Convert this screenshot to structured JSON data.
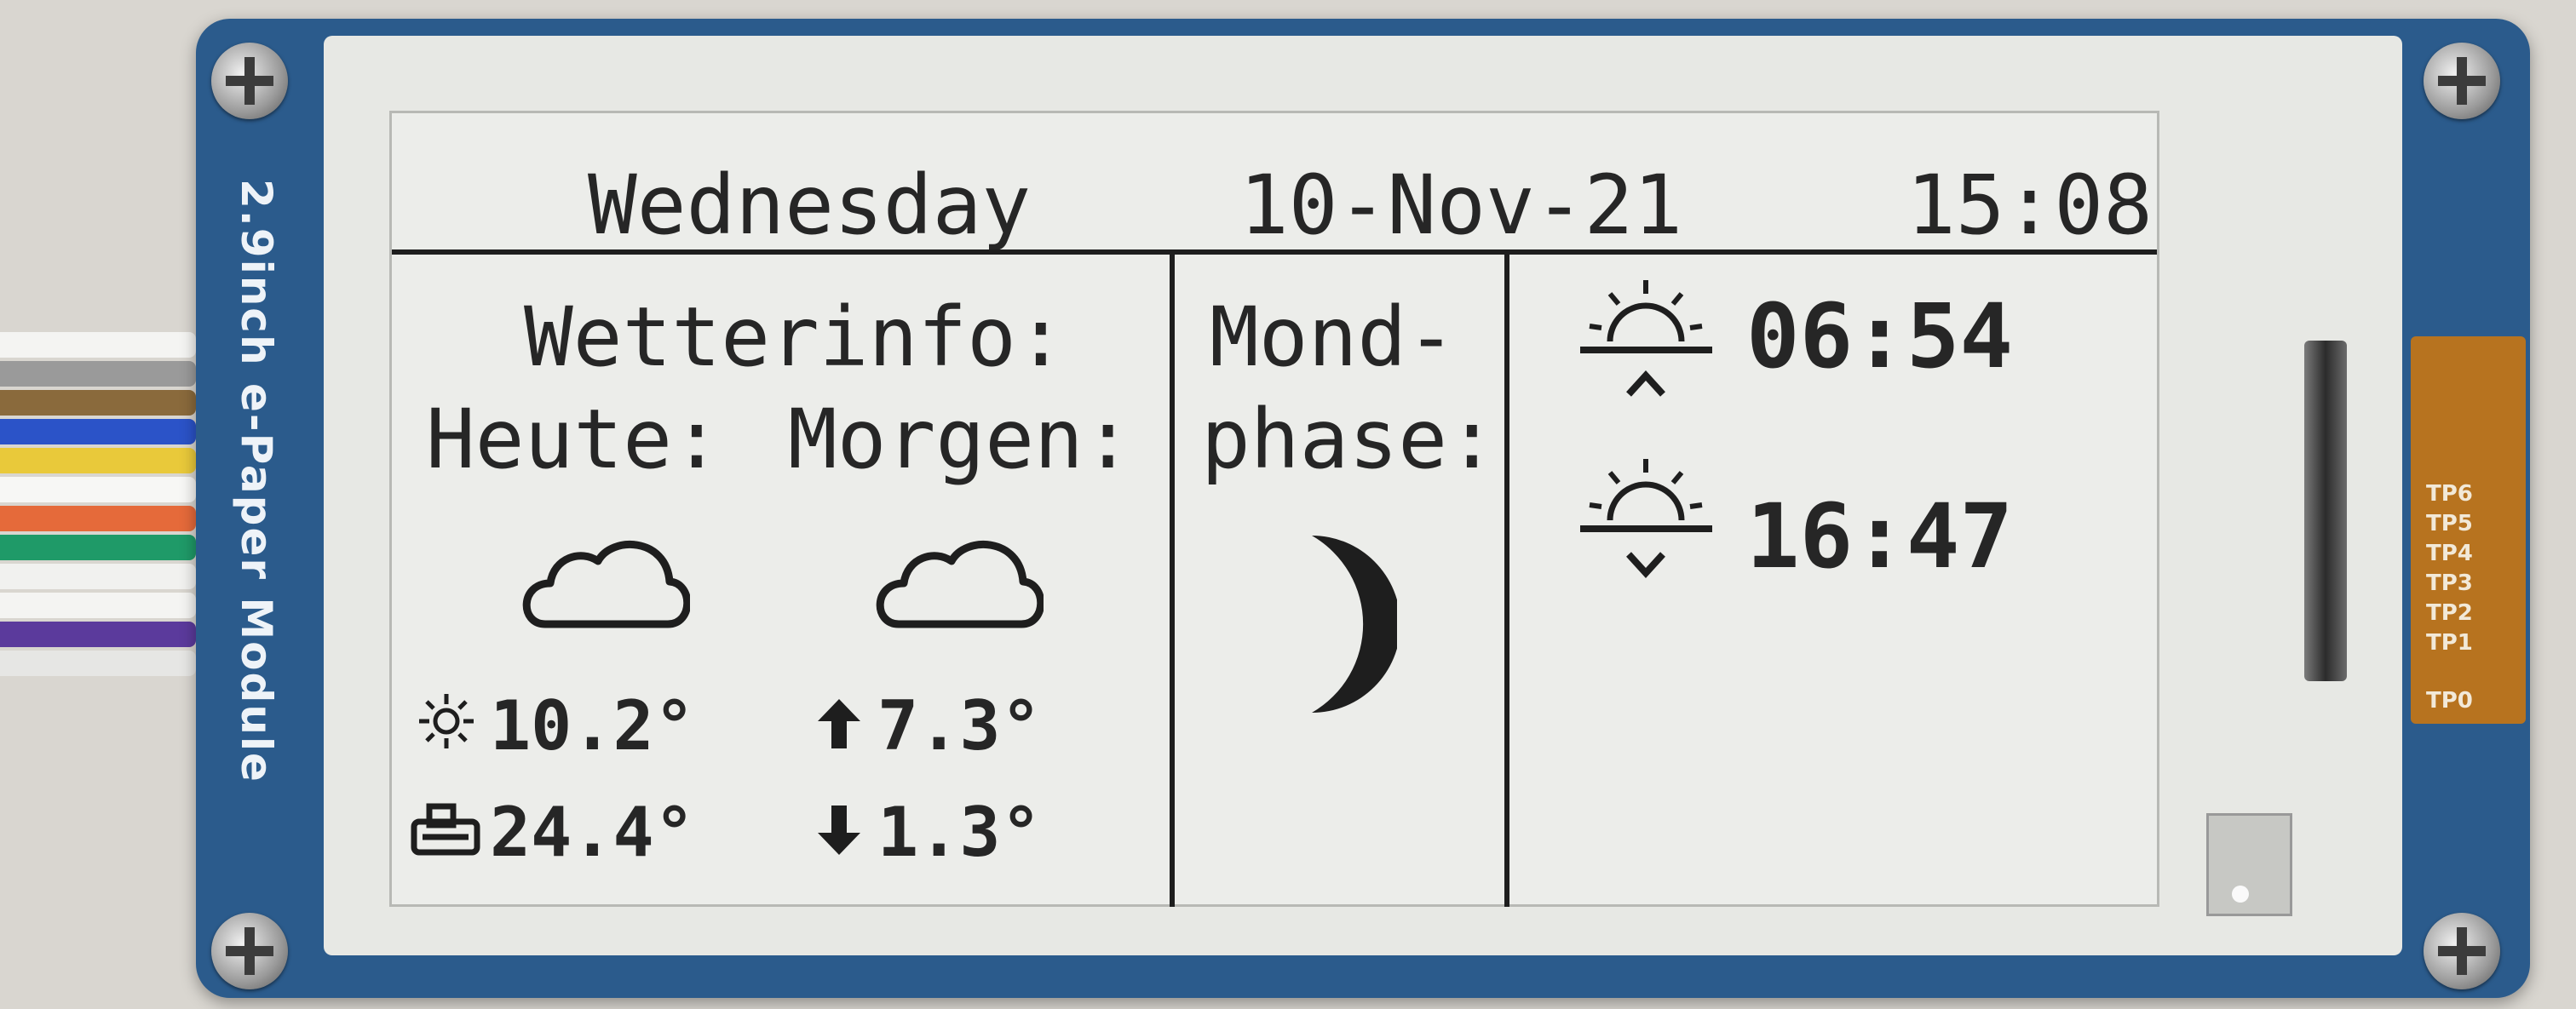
{
  "display": {
    "day": "Wednesday",
    "date": "10-Nov-21",
    "time": "15:08"
  },
  "weather": {
    "heading": "Wetterinfo:",
    "today_label": "Heute:",
    "tomorrow_label": "Morgen:",
    "today_icon": "cloud-icon",
    "tomorrow_icon": "cloud-icon",
    "temperature": "10.2°",
    "humidity": "24.4°",
    "max_temp": "7.3°",
    "min_temp": "1.3°"
  },
  "moon": {
    "heading_line1": "Mond-",
    "heading_line2": "phase:",
    "icon": "crescent-moon-icon"
  },
  "sun": {
    "sunrise": "06:54",
    "sunset": "16:47"
  },
  "hardware": {
    "module_label": "2.9inch e-Paper Module",
    "tp_labels": [
      "TP6",
      "TP5",
      "TP4",
      "TP3",
      "TP2",
      "TP1",
      "TP0"
    ]
  }
}
